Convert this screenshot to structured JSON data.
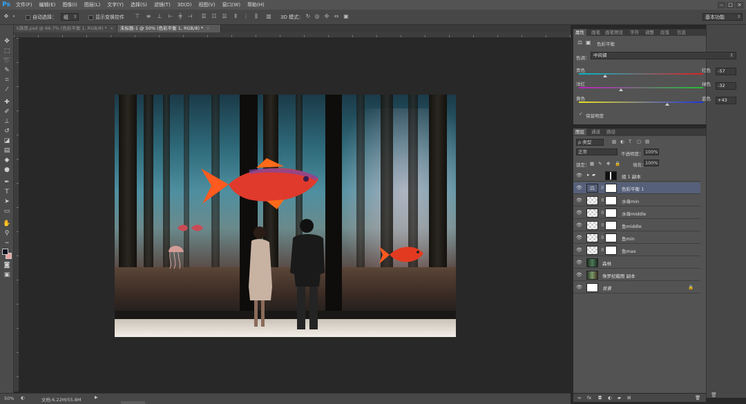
{
  "app": {
    "logo": "Ps"
  },
  "menubar": {
    "items": [
      "文件(F)",
      "编辑(E)",
      "图像(I)",
      "图层(L)",
      "文字(Y)",
      "选择(S)",
      "滤镜(T)",
      "3D(D)",
      "视图(V)",
      "窗口(W)",
      "帮助(H)"
    ]
  },
  "optbar": {
    "auto_select_label": "自动选择：",
    "auto_select_value": "组",
    "show_transform_label": "显示变换控件",
    "mode_label": "3D 模式："
  },
  "workspace": {
    "value": "基本功能"
  },
  "tabs": [
    {
      "label": "k族馆.psd @ 66.7% (色彩平衡 1, RGB/8) *",
      "close": "×"
    },
    {
      "label": "未标题-1 @ 50% (色彩平衡 1, RGB/8) *",
      "close": "×"
    }
  ],
  "panel_tabs": [
    "属性",
    "画笔",
    "画笔预设",
    "字符",
    "调整",
    "段落",
    "信息"
  ],
  "properties": {
    "title": "色彩平衡",
    "tone_label": "色调：",
    "tone_value": "中间调",
    "sliders": [
      {
        "left": "青色",
        "right": "红色",
        "value": "-57",
        "pos": 0.21
      },
      {
        "left": "洋红",
        "right": "绿色",
        "value": "-32",
        "pos": 0.34
      },
      {
        "left": "黄色",
        "right": "蓝色",
        "value": "+43",
        "pos": 0.71
      }
    ],
    "preserve_label": "保留明度",
    "preserve_check": "✓"
  },
  "layers_tabs": [
    "图层",
    "通道",
    "路径"
  ],
  "layers": {
    "filter_label": "ρ 类型",
    "blend_mode": "正常",
    "opacity_label": "不透明度：",
    "opacity_value": "100%",
    "lock_label": "锁定：",
    "fill_label": "填充：",
    "fill_value": "100%",
    "rows": [
      {
        "name": "组 1 副本",
        "type": "group"
      },
      {
        "name": "色彩平衡 1",
        "type": "adjustment",
        "selected": true
      },
      {
        "name": "水母min",
        "type": "mask"
      },
      {
        "name": "水母middle",
        "type": "mask"
      },
      {
        "name": "鱼middle",
        "type": "mask"
      },
      {
        "name": "鱼min",
        "type": "mask"
      },
      {
        "name": "鱼max",
        "type": "mask"
      },
      {
        "name": "森林",
        "type": "image"
      },
      {
        "name": "侏罗纪截图 副本",
        "type": "image"
      },
      {
        "name": "背景",
        "type": "background"
      }
    ]
  },
  "statusbar": {
    "zoom": "50%",
    "doc_info": "文档:6.22M/55.8M"
  },
  "colors": {
    "foreground": "#0d0f1c",
    "background": "#e8a0a0",
    "selected_layer": "#56607a",
    "accent": "#31a8ff"
  }
}
